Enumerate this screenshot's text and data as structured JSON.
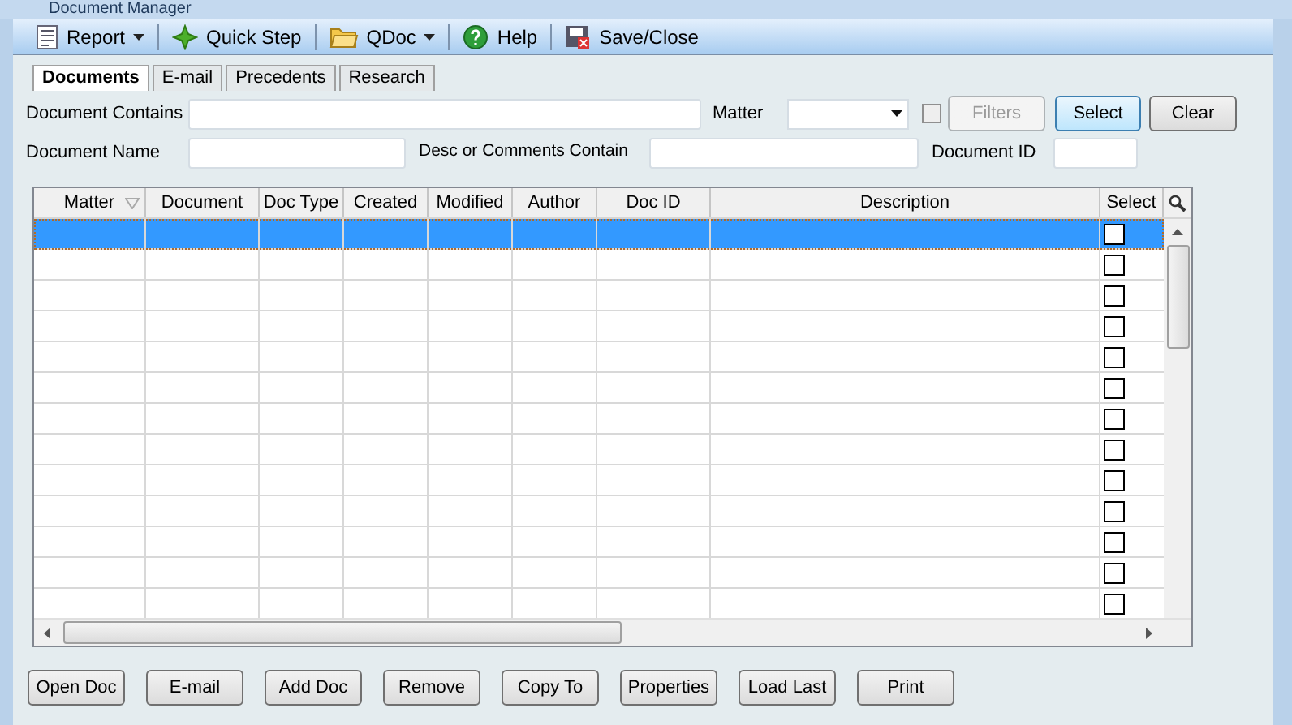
{
  "window": {
    "title": "Document Manager"
  },
  "toolbar": [
    {
      "label": "Report",
      "kind": "dropdown"
    },
    {
      "label": "Quick Step",
      "kind": "button"
    },
    {
      "label": "QDoc",
      "kind": "dropdown"
    },
    {
      "label": "Help",
      "kind": "button"
    },
    {
      "label": "Save/Close",
      "kind": "button"
    }
  ],
  "tabs": [
    {
      "label": "Documents",
      "selected": true
    },
    {
      "label": "E-mail",
      "selected": false
    },
    {
      "label": "Precedents",
      "selected": false
    },
    {
      "label": "Research",
      "selected": false
    }
  ],
  "filters": {
    "document_contains": {
      "label": "Document Contains"
    },
    "matter": {
      "label": "Matter"
    },
    "filters_checkbox": {
      "checked": false
    },
    "filters_button": {
      "label": "Filters",
      "disabled": true
    },
    "select_button": {
      "label": "Select"
    },
    "clear_button": {
      "label": "Clear"
    },
    "document_name": {
      "label": "Document Name"
    },
    "desc_contains": {
      "label": "Desc or Comments Contain"
    },
    "document_id": {
      "label": "Document ID"
    }
  },
  "table": {
    "columns": [
      "Matter",
      "Document",
      "Doc Type",
      "Created",
      "Modified",
      "Author",
      "Doc ID",
      "Description",
      "Select"
    ],
    "rows": [
      {
        "selected": true,
        "checked": false
      },
      {
        "selected": false,
        "checked": false
      },
      {
        "selected": false,
        "checked": false
      },
      {
        "selected": false,
        "checked": false
      },
      {
        "selected": false,
        "checked": false
      },
      {
        "selected": false,
        "checked": false
      },
      {
        "selected": false,
        "checked": false
      },
      {
        "selected": false,
        "checked": false
      },
      {
        "selected": false,
        "checked": false
      },
      {
        "selected": false,
        "checked": false
      },
      {
        "selected": false,
        "checked": false
      },
      {
        "selected": false,
        "checked": false
      },
      {
        "selected": false,
        "checked": false
      }
    ]
  },
  "buttons": [
    "Open Doc",
    "E-mail",
    "Add Doc",
    "Remove",
    "Copy To",
    "Properties",
    "Load Last",
    "Print"
  ]
}
